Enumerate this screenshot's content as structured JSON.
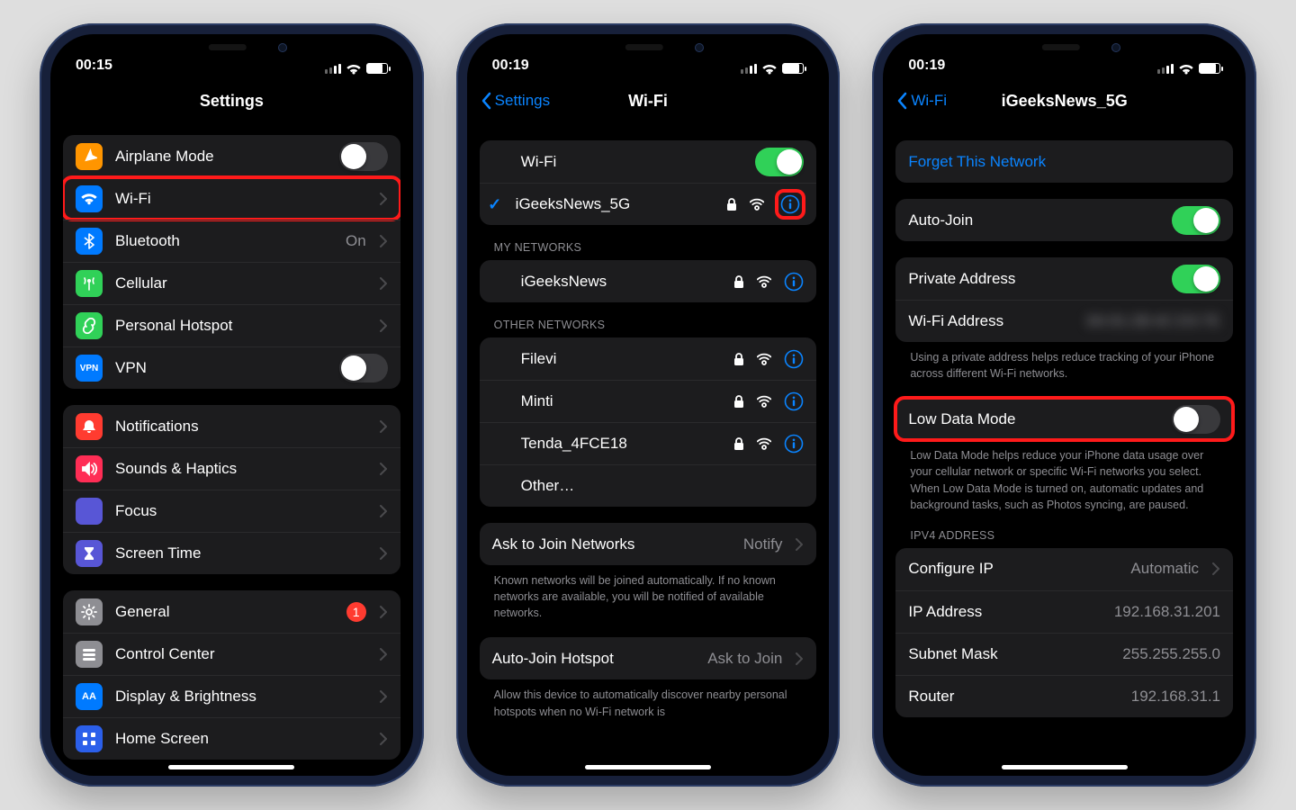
{
  "phone1": {
    "time": "00:15",
    "title": "Settings",
    "rows": {
      "airplane": "Airplane Mode",
      "wifi": "Wi-Fi",
      "bluetooth": "Bluetooth",
      "bluetooth_val": "On",
      "cellular": "Cellular",
      "hotspot": "Personal Hotspot",
      "vpn": "VPN",
      "notifications": "Notifications",
      "sounds": "Sounds & Haptics",
      "focus": "Focus",
      "screentime": "Screen Time",
      "general": "General",
      "general_badge": "1",
      "control": "Control Center",
      "display": "Display & Brightness",
      "home": "Home Screen"
    }
  },
  "phone2": {
    "time": "00:19",
    "back": "Settings",
    "title": "Wi-Fi",
    "wifi_label": "Wi-Fi",
    "connected": "iGeeksNews_5G",
    "headers": {
      "my": "MY NETWORKS",
      "other": "OTHER NETWORKS"
    },
    "my": [
      "iGeeksNews"
    ],
    "other": [
      "Filevi",
      "Minti",
      "Tenda_4FCE18",
      "Other…"
    ],
    "ask": {
      "label": "Ask to Join Networks",
      "value": "Notify"
    },
    "ask_foot": "Known networks will be joined automatically. If no known networks are available, you will be notified of available networks.",
    "auto": {
      "label": "Auto-Join Hotspot",
      "value": "Ask to Join"
    },
    "auto_foot": "Allow this device to automatically discover nearby personal hotspots when no Wi-Fi network is"
  },
  "phone3": {
    "time": "00:19",
    "back": "Wi-Fi",
    "title": "iGeeksNews_5G",
    "forget": "Forget This Network",
    "autojoin": "Auto-Join",
    "private": "Private Address",
    "wifi_addr_label": "Wi-Fi Address",
    "wifi_addr_val": "•••••••••••",
    "priv_foot": "Using a private address helps reduce tracking of your iPhone across different Wi-Fi networks.",
    "ldm": "Low Data Mode",
    "ldm_foot": "Low Data Mode helps reduce your iPhone data usage over your cellular network or specific Wi-Fi networks you select. When Low Data Mode is turned on, automatic updates and background tasks, such as Photos syncing, are paused.",
    "ipv4_header": "IPV4 ADDRESS",
    "configure": {
      "label": "Configure IP",
      "value": "Automatic"
    },
    "ip": {
      "label": "IP Address",
      "value": "192.168.31.201"
    },
    "subnet": {
      "label": "Subnet Mask",
      "value": "255.255.255.0"
    },
    "router": {
      "label": "Router",
      "value": "192.168.31.1"
    }
  }
}
